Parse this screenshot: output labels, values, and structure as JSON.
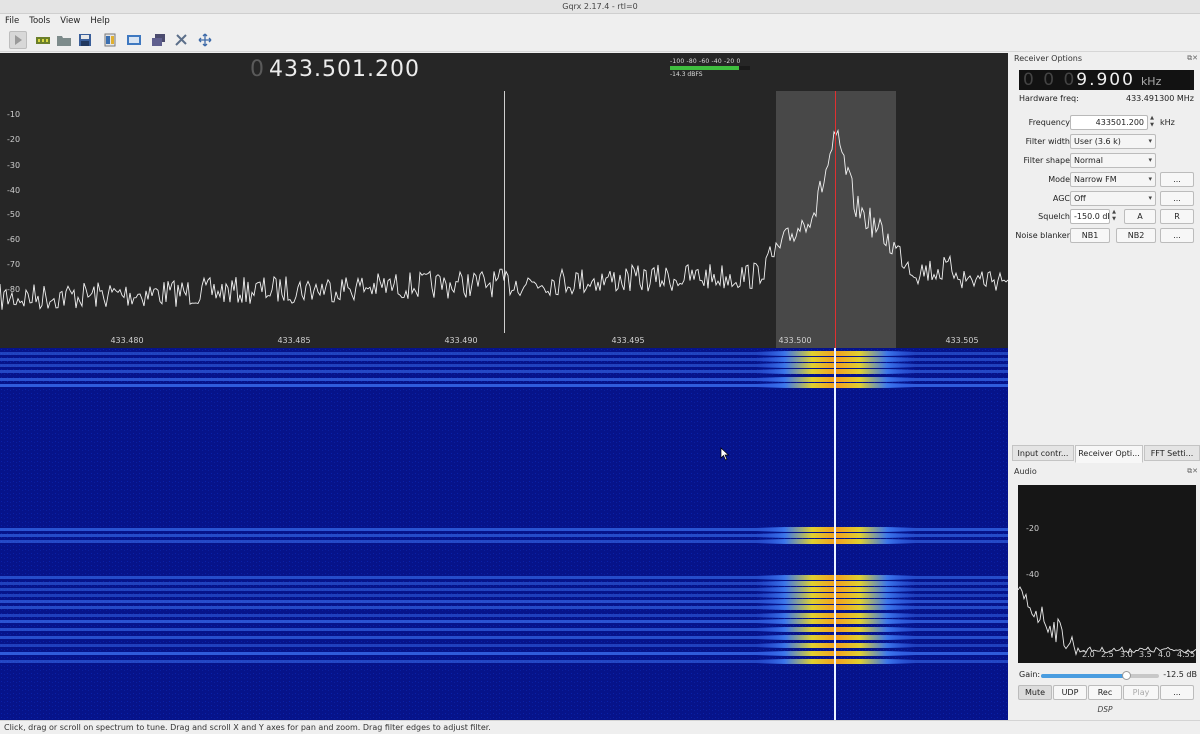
{
  "window": {
    "title": "Gqrx 2.17.4 - rtl=0"
  },
  "menu": [
    "File",
    "Tools",
    "View",
    "Help"
  ],
  "toolbar": {
    "icons": [
      "start-dsp-icon",
      "device-config-icon",
      "open-icon",
      "save-icon",
      "recording-icon",
      "iq-tool-icon",
      "remote-control-icon",
      "dx-cluster-icon",
      "fullscreen-icon"
    ]
  },
  "spectrum": {
    "frequency_dim": "0",
    "frequency": "433.501.200",
    "meter_scale": "-100  -80  -60  -40  -20   0",
    "meter_level_fraction": 0.86,
    "meter_value": "-14.3 dBFS",
    "y_ticks": [
      "-10",
      "-20",
      "-30",
      "-40",
      "-50",
      "-60",
      "-70",
      "-80"
    ],
    "x_ticks": [
      "433.480",
      "433.485",
      "433.490",
      "433.495",
      "433.500",
      "433.505"
    ]
  },
  "status_bar": {
    "text": "Click, drag or scroll on spectrum to tune. Drag and scroll X and Y axes for pan and zoom. Drag filter edges to adjust filter."
  },
  "receiver": {
    "title": "Receiver Options",
    "offset_dim": "0 0 0",
    "offset": "9.900",
    "offset_unit": "kHz",
    "hw_label": "Hardware freq:",
    "hw_value": "433.491300 MHz",
    "frequency_label": "Frequency",
    "frequency_value": "433501.200",
    "frequency_unit": "kHz",
    "filter_width_label": "Filter width",
    "filter_width_value": "User (3.6 k)",
    "filter_shape_label": "Filter shape",
    "filter_shape_value": "Normal",
    "mode_label": "Mode",
    "mode_value": "Narrow FM",
    "agc_label": "AGC",
    "agc_value": "Off",
    "squelch_label": "Squelch",
    "squelch_value": "-150.0 dB",
    "squelch_a": "A",
    "squelch_r": "R",
    "noise_blanker_label": "Noise blanker",
    "nb1": "NB1",
    "nb2": "NB2",
    "more": "..."
  },
  "tabs": [
    "Input contr...",
    "Receiver Opti...",
    "FFT Setti..."
  ],
  "audio": {
    "title": "Audio",
    "y_ticks": [
      "-20",
      "-40"
    ],
    "x_ticks": [
      "2.0",
      "2.5",
      "3.0",
      "3.5",
      "4.0",
      "4.5",
      "5"
    ],
    "gain_label": "Gain:",
    "gain_value": "-12.5 dB",
    "gain_fraction": 0.72,
    "buttons": [
      "Mute",
      "UDP",
      "Rec",
      "Play",
      "..."
    ],
    "dsp_label": "DSP"
  }
}
